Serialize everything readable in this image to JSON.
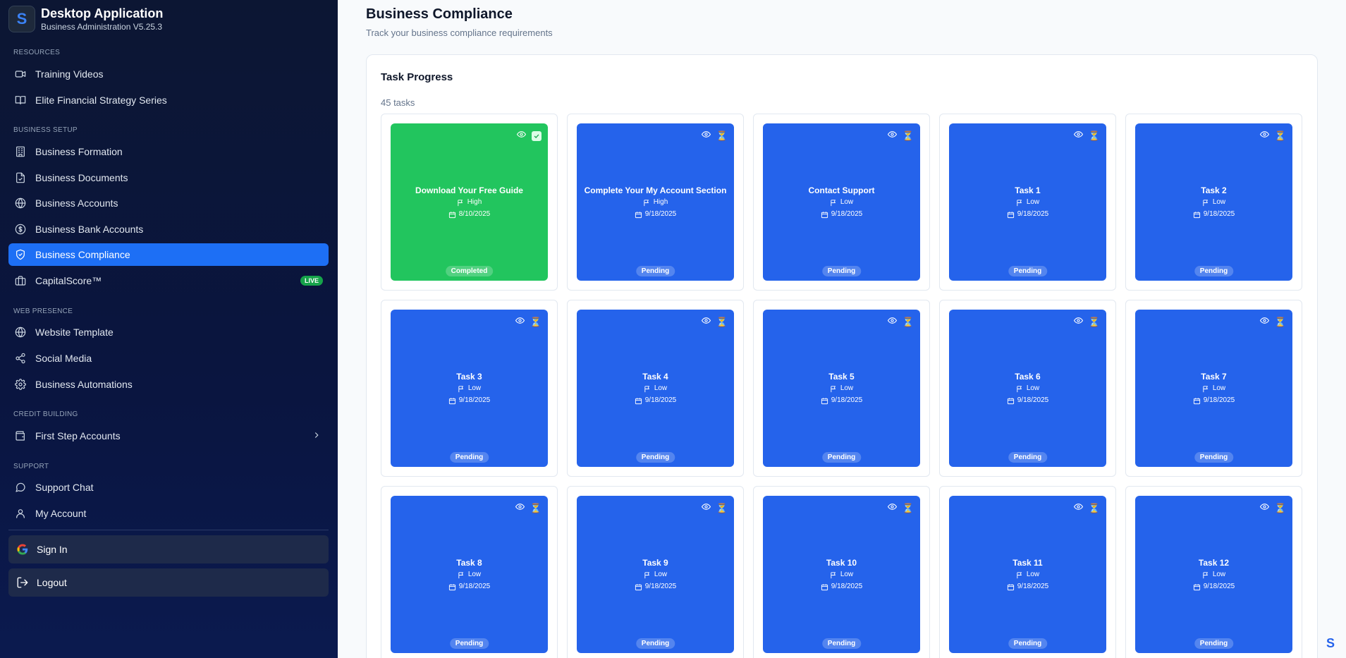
{
  "app": {
    "title": "Desktop Application",
    "subtitle": "Business Administration V5.25.3",
    "logo_letter": "S"
  },
  "sidebar": {
    "sections": {
      "resources": "RESOURCES",
      "business_setup": "BUSINESS SETUP",
      "web_presence": "WEB PRESENCE",
      "credit_building": "CREDIT BUILDING",
      "support": "SUPPORT"
    },
    "items": {
      "training_videos": "Training Videos",
      "elite_series": "Elite Financial Strategy Series",
      "business_formation": "Business Formation",
      "business_documents": "Business Documents",
      "business_accounts": "Business Accounts",
      "business_bank_accounts": "Business Bank Accounts",
      "business_compliance": "Business Compliance",
      "capitalscore": "CapitalScore™",
      "website_template": "Website Template",
      "social_media": "Social Media",
      "business_automations": "Business Automations",
      "first_step_accounts": "First Step Accounts",
      "support_chat": "Support Chat",
      "my_account": "My Account"
    },
    "live_badge": "LIVE",
    "sign_in": "Sign In",
    "logout": "Logout",
    "active_color": "#1d6ff5"
  },
  "main": {
    "title": "Business Compliance",
    "subtitle": "Track your business compliance requirements",
    "panel_title": "Task Progress",
    "task_count": "45 tasks",
    "tasks": [
      {
        "title": "Download Your Free Guide",
        "priority": "High",
        "date": "8/10/2025",
        "status": "Completed"
      },
      {
        "title": "Complete Your My Account Section",
        "priority": "High",
        "date": "9/18/2025",
        "status": "Pending"
      },
      {
        "title": "Contact Support",
        "priority": "Low",
        "date": "9/18/2025",
        "status": "Pending"
      },
      {
        "title": "Task 1",
        "priority": "Low",
        "date": "9/18/2025",
        "status": "Pending"
      },
      {
        "title": "Task 2",
        "priority": "Low",
        "date": "9/18/2025",
        "status": "Pending"
      },
      {
        "title": "Task 3",
        "priority": "Low",
        "date": "9/18/2025",
        "status": "Pending"
      },
      {
        "title": "Task 4",
        "priority": "Low",
        "date": "9/18/2025",
        "status": "Pending"
      },
      {
        "title": "Task 5",
        "priority": "Low",
        "date": "9/18/2025",
        "status": "Pending"
      },
      {
        "title": "Task 6",
        "priority": "Low",
        "date": "9/18/2025",
        "status": "Pending"
      },
      {
        "title": "Task 7",
        "priority": "Low",
        "date": "9/18/2025",
        "status": "Pending"
      },
      {
        "title": "Task 8",
        "priority": "Low",
        "date": "9/18/2025",
        "status": "Pending"
      },
      {
        "title": "Task 9",
        "priority": "Low",
        "date": "9/18/2025",
        "status": "Pending"
      },
      {
        "title": "Task 10",
        "priority": "Low",
        "date": "9/18/2025",
        "status": "Pending"
      },
      {
        "title": "Task 11",
        "priority": "Low",
        "date": "9/18/2025",
        "status": "Pending"
      },
      {
        "title": "Task 12",
        "priority": "Low",
        "date": "9/18/2025",
        "status": "Pending"
      }
    ],
    "colors": {
      "completed": "#22c55e",
      "pending": "#2563eb"
    }
  }
}
